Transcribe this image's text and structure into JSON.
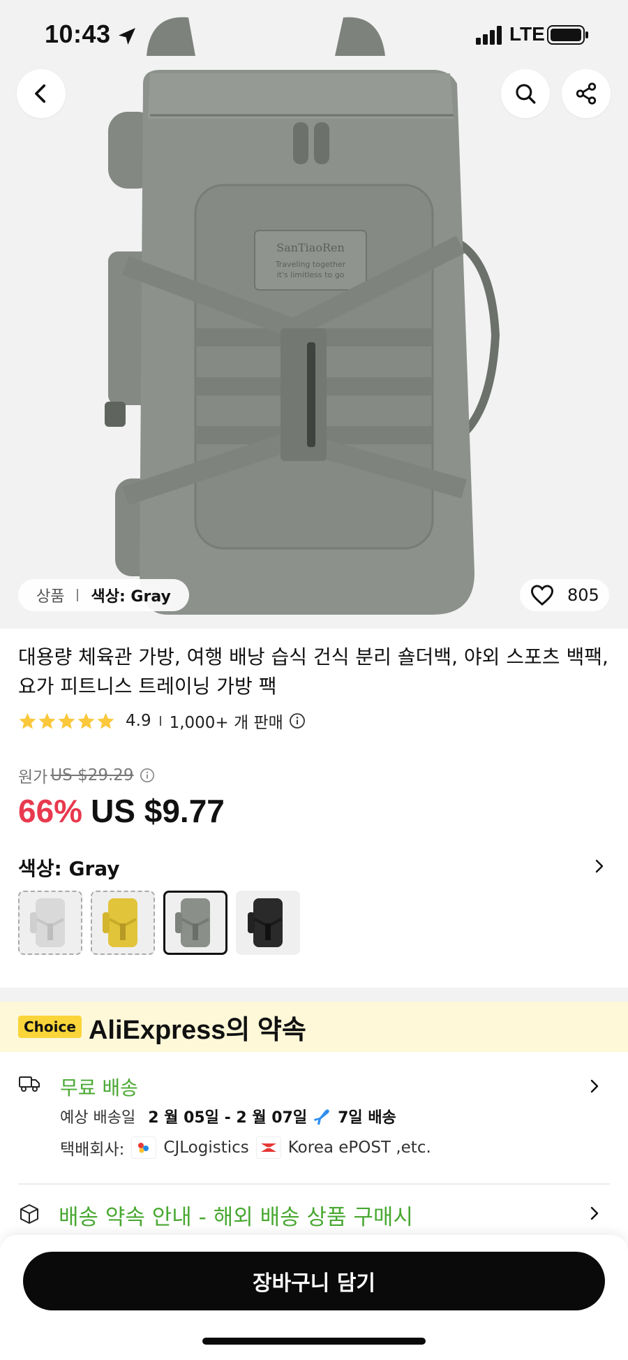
{
  "status_bar": {
    "time": "10:43",
    "network": "LTE"
  },
  "colors": {
    "accent_red": "#e8394e",
    "green": "#49a832",
    "choice_yellow": "#fad53a",
    "banner_bg": "#fff8d8"
  },
  "hero": {
    "breadcrumb_category": "상품",
    "breadcrumb_selected": "색상: Gray",
    "likes": "805",
    "brand_patch": "SanTiaoRen",
    "brand_slogan_1": "Traveling together",
    "brand_slogan_2": "it's limitless to go",
    "icons": {
      "back": "chevron-left-icon",
      "search": "search-icon",
      "share": "share-icon",
      "like": "heart-icon"
    }
  },
  "product": {
    "title": "대용량 체육관 가방, 여행 배낭 습식 건식 분리 숄더백, 야외 스포츠 백팩, 요가 피트니스 트레이닝 가방 팩",
    "rating": "4.9",
    "rating_stars": 5,
    "sold": "1,000+ 개 판매",
    "original_price_label": "원가",
    "original_price": "US $29.29",
    "discount": "66%",
    "price": "US $9.77",
    "color_label": "색상: Gray",
    "swatches": [
      {
        "color": "#d9d9d9",
        "selected": false
      },
      {
        "color": "#e2c43b",
        "selected": false
      },
      {
        "color": "#8a8f89",
        "selected": true
      },
      {
        "color": "#2a2a2a",
        "selected": false
      }
    ]
  },
  "choice": {
    "badge": "Choice",
    "title": "AliExpress의 약속"
  },
  "shipping": {
    "free": "무료 배송",
    "eta_label": "예상 배송일",
    "eta_value": "2 월 05일 - 2 월 07일",
    "eta_days": "7일 배송",
    "carrier_label": "택배회사:",
    "carrier_1": "CJLogistics",
    "carrier_2": "Korea ePOST ,etc."
  },
  "promise": {
    "text": "배송 약속 안내 - 해외 배송 상품 구매시"
  },
  "bottom": {
    "cart_label": "장바구니 담기"
  }
}
